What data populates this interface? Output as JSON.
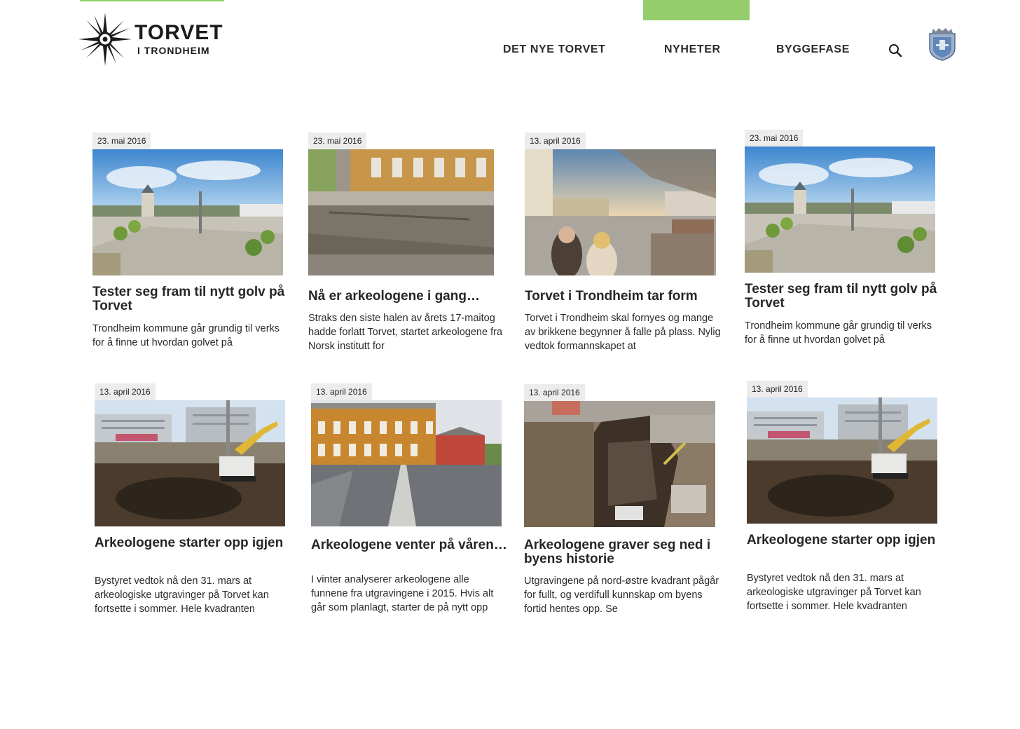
{
  "header": {
    "logo_title": "TORVET",
    "logo_subtitle": "I TRONDHEIM",
    "nav": [
      "DET NYE TORVET",
      "NYHETER",
      "BYGGEFASE"
    ],
    "active_color": "#96cd6c"
  },
  "icons": [
    "search-icon",
    "crest-icon",
    "logo-star-icon"
  ],
  "cards": [
    {
      "date": "23. mai 2016",
      "title": "Tester seg fram til nytt golv på Torvet",
      "excerpt": "Trondheim kommune går grundig til verks for å finne ut hvordan golvet på"
    },
    {
      "date": "23. mai 2016",
      "title": "Nå er arkeologene i gang…",
      "excerpt": "Straks den siste halen av årets 17-maitog hadde forlatt Torvet, startet arkeologene fra Norsk institutt for"
    },
    {
      "date": "13. april 2016",
      "title": "Torvet i Trondheim tar form",
      "excerpt": "Torvet i Trondheim skal fornyes og mange av brikkene begynner å falle på plass. Nylig vedtok formannskapet at"
    },
    {
      "date": "23. mai 2016",
      "title": "Tester seg fram til nytt golv på Torvet",
      "excerpt": "Trondheim kommune går grundig til verks for å finne ut hvordan golvet på"
    },
    {
      "date": "13. april 2016",
      "title": "Arkeologene starter opp igjen",
      "excerpt": "  Bystyret vedtok nå den 31. mars at arkeologiske utgravinger på Torvet kan fortsette i sommer. Hele kvadranten"
    },
    {
      "date": "13. april 2016",
      "title": "Arkeologene venter på våren…",
      "excerpt": "I vinter analyserer arkeologene alle funnene fra utgravingene i 2015. Hvis alt går som planlagt, starter de på nytt opp"
    },
    {
      "date": "13. april 2016",
      "title": "Arkeologene graver seg ned i byens historie",
      "excerpt": "Utgravingene på nord-østre kvadrant pågår for fullt, og verdifull kunnskap om byens fortid hentes opp. Se"
    },
    {
      "date": "13. april 2016",
      "title": "Arkeologene starter opp igjen",
      "excerpt": "  Bystyret vedtok nå den 31. mars at arkeologiske utgravinger på Torvet kan fortsette i sommer. Hele kvadranten"
    }
  ]
}
